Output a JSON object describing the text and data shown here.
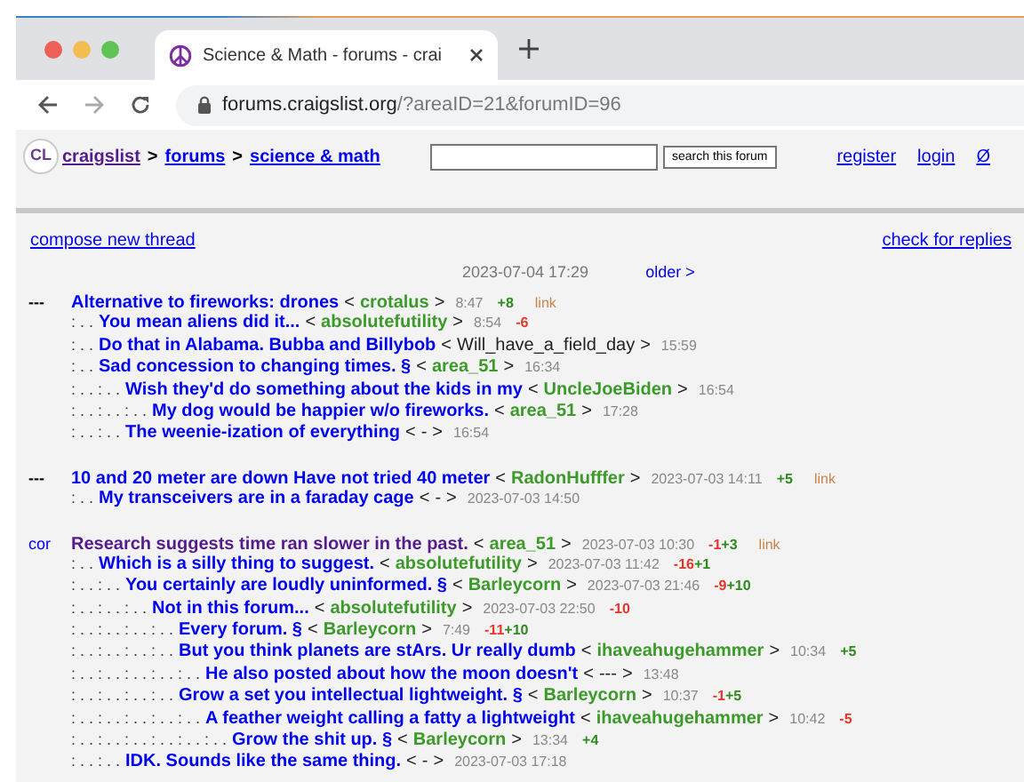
{
  "browser": {
    "tab_title": "Science & Math - forums - crai",
    "url_host": "forums.craigslist.org",
    "url_path": "/?areaID=21&forumID=96"
  },
  "header": {
    "logo": "CL",
    "breadcrumbs": [
      {
        "label": "craigslist",
        "visited": true
      },
      {
        "label": "forums",
        "visited": false
      },
      {
        "label": "science & math",
        "visited": false
      }
    ],
    "separators": [
      ">",
      ">"
    ],
    "search_button": "search this forum",
    "links": [
      "register",
      "login",
      "Ø"
    ]
  },
  "actions": {
    "compose": "compose new thread",
    "check": "check for replies"
  },
  "pager": {
    "date": "2023-07-04 17:29",
    "older": "older >"
  },
  "threads": [
    {
      "marker": "---",
      "marker_linked": false,
      "posts": [
        {
          "title": "Alternative to fireworks: drones",
          "visited": false,
          "open": "<",
          "author": "crotalus",
          "author_linked": true,
          "close": ">",
          "time": "8:47",
          "votes": [
            {
              "text": "+8",
              "kind": "up"
            }
          ],
          "link": "link"
        },
        {
          "prefix": ": . .",
          "title": "You mean aliens did it...",
          "visited": false,
          "open": "<",
          "author": "absolutefutility",
          "author_linked": true,
          "close": ">",
          "time": "8:54",
          "votes": [
            {
              "text": "-6",
              "kind": "down"
            }
          ]
        },
        {
          "prefix": ": . .",
          "title": "Do that in Alabama. Bubba and Billybob",
          "visited": false,
          "open": "<",
          "author": "Will_have_a_field_day",
          "author_linked": false,
          "close": ">",
          "time": "15:59"
        },
        {
          "prefix": ": . .",
          "title": "Sad concession to changing times. §",
          "visited": false,
          "open": "<",
          "author": "area_51",
          "author_linked": true,
          "close": ">",
          "time": "16:34"
        },
        {
          "prefix": ": . . : . .",
          "title": "Wish they'd do something about the kids in my",
          "visited": false,
          "open": "<",
          "author": "UncleJoeBiden",
          "author_linked": true,
          "close": ">",
          "time": "16:54"
        },
        {
          "prefix": ": . . : . . : . .",
          "title": "My dog would be happier w/o fireworks.",
          "visited": false,
          "open": "<",
          "author": "area_51",
          "author_linked": true,
          "close": ">",
          "time": "17:28"
        },
        {
          "prefix": ": . . : . .",
          "title": "The weenie-ization of everything",
          "visited": false,
          "open": "<",
          "author": "-",
          "author_linked": false,
          "close": ">",
          "time": "16:54"
        }
      ]
    },
    {
      "marker": "---",
      "marker_linked": false,
      "posts": [
        {
          "title": "10 and 20 meter are down Have not tried 40 meter",
          "visited": false,
          "open": "<",
          "author": "RadonHufffer",
          "author_linked": true,
          "close": ">",
          "time": "2023-07-03 14:11",
          "votes": [
            {
              "text": "+5",
              "kind": "up"
            }
          ],
          "link": "link"
        },
        {
          "prefix": ": . .",
          "title": "My transceivers are in a faraday cage",
          "visited": false,
          "open": "<",
          "author": "-",
          "author_linked": false,
          "close": ">",
          "time": "2023-07-03 14:50"
        }
      ]
    },
    {
      "marker": "cor",
      "marker_linked": true,
      "posts": [
        {
          "title": "Research suggests time ran slower in the past.",
          "visited": true,
          "open": "<",
          "author": "area_51",
          "author_linked": true,
          "close": ">",
          "time": "2023-07-03 10:30",
          "votes": [
            {
              "text": "-1",
              "kind": "down"
            },
            {
              "text": "+3",
              "kind": "up"
            }
          ],
          "link": "link"
        },
        {
          "prefix": ": . .",
          "title": "Which is a silly thing to suggest.",
          "visited": false,
          "open": "<",
          "author": "absolutefutility",
          "author_linked": true,
          "close": ">",
          "time": "2023-07-03 11:42",
          "votes": [
            {
              "text": "-16",
              "kind": "down"
            },
            {
              "text": "+1",
              "kind": "up"
            }
          ]
        },
        {
          "prefix": ": . . : . .",
          "title": "You certainly are loudly uninformed. §",
          "visited": false,
          "open": "<",
          "author": "Barleycorn",
          "author_linked": true,
          "close": ">",
          "time": "2023-07-03 21:46",
          "votes": [
            {
              "text": "-9",
              "kind": "down"
            },
            {
              "text": "+10",
              "kind": "up"
            }
          ]
        },
        {
          "prefix": ": . . : . . : . .",
          "title": "Not in this forum...",
          "visited": false,
          "open": "<",
          "author": "absolutefutility",
          "author_linked": true,
          "close": ">",
          "time": "2023-07-03 22:50",
          "votes": [
            {
              "text": "-10",
              "kind": "down"
            }
          ]
        },
        {
          "prefix": ": . . : . . : . . : . .",
          "title": "Every forum. §",
          "visited": false,
          "open": "<",
          "author": "Barleycorn",
          "author_linked": true,
          "close": ">",
          "time": "7:49",
          "votes": [
            {
              "text": "-11",
              "kind": "down"
            },
            {
              "text": "+10",
              "kind": "up"
            }
          ]
        },
        {
          "prefix": ": . . : . . : . . : . .",
          "title": "But you think planets are stArs. Ur really dumb",
          "visited": false,
          "open": "<",
          "author": "ihaveahugehammer",
          "author_linked": true,
          "close": ">",
          "time": "10:34",
          "votes": [
            {
              "text": "+5",
              "kind": "up"
            }
          ]
        },
        {
          "prefix": ": . . : . . : . . : . . : . .",
          "title": "He also posted about how the moon doesn't",
          "visited": false,
          "open": "<",
          "author": "---",
          "author_linked": false,
          "close": ">",
          "time": "13:48"
        },
        {
          "prefix": ": . . : . . : . . : . .",
          "title": "Grow a set you intellectual lightweight. §",
          "visited": false,
          "open": "<",
          "author": "Barleycorn",
          "author_linked": true,
          "close": ">",
          "time": "10:37",
          "votes": [
            {
              "text": "-1",
              "kind": "down"
            },
            {
              "text": "+5",
              "kind": "up"
            }
          ]
        },
        {
          "prefix": ": . . : . . : . . : . . : . .",
          "title": "A feather weight calling a fatty a lightweight",
          "visited": false,
          "open": "<",
          "author": "ihaveahugehammer",
          "author_linked": true,
          "close": ">",
          "time": "10:42",
          "votes": [
            {
              "text": "-5",
              "kind": "down"
            }
          ]
        },
        {
          "prefix": ": . . : . . : . . : . . : . . : . .",
          "title": "Grow the shit up. §",
          "visited": false,
          "open": "<",
          "author": "Barleycorn",
          "author_linked": true,
          "close": ">",
          "time": "13:34",
          "votes": [
            {
              "text": "+4",
              "kind": "up"
            }
          ]
        },
        {
          "prefix": ": . . : . .",
          "title": "IDK. Sounds like the same thing.",
          "visited": false,
          "open": "<",
          "author": "-",
          "author_linked": false,
          "close": ">",
          "time": "2023-07-03 17:18"
        }
      ]
    }
  ]
}
